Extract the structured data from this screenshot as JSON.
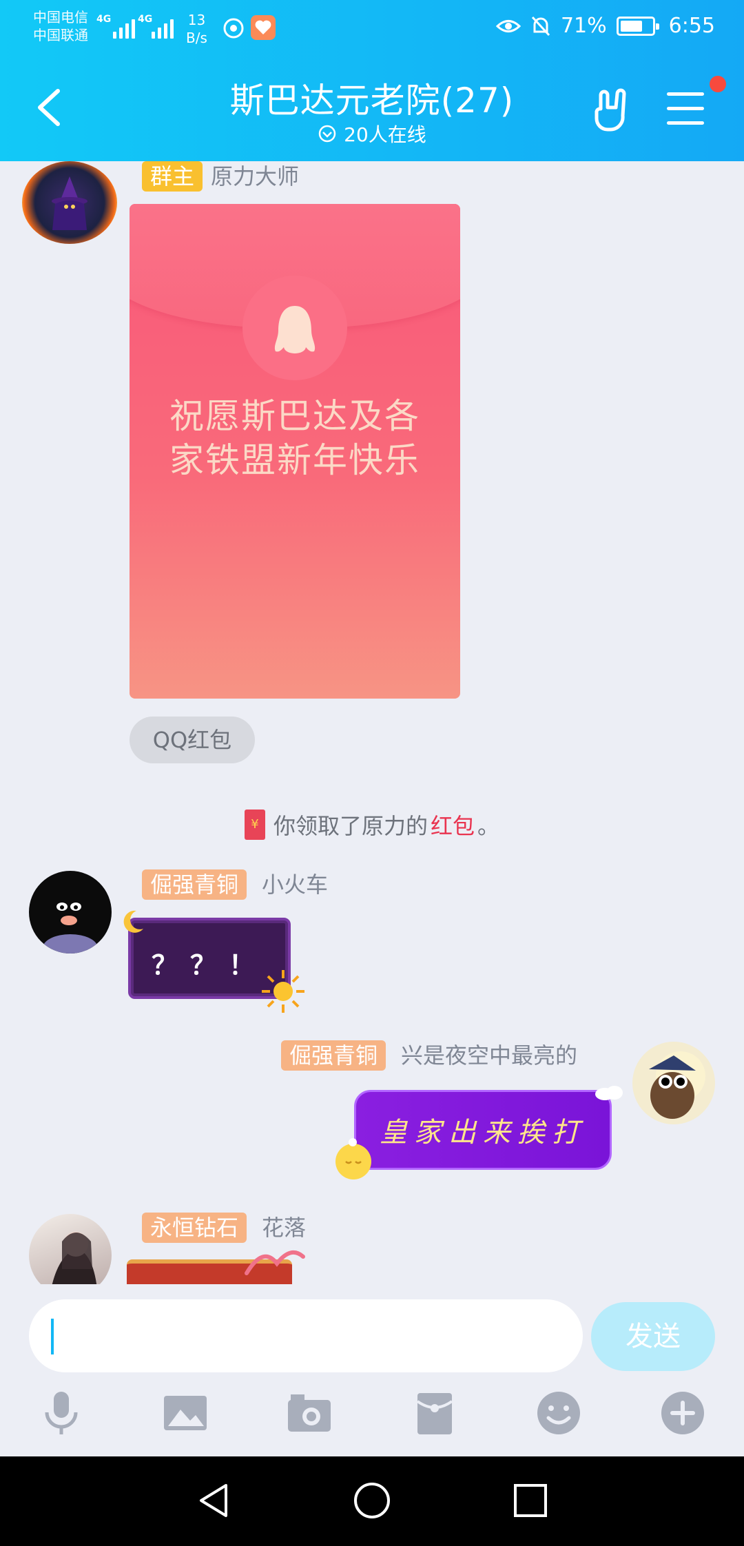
{
  "status_bar": {
    "carrier1": "中国电信",
    "carrier2": "中国联通",
    "net1": "4G",
    "net2": "4G",
    "speed_value": "13",
    "speed_unit": "B/s",
    "battery": "71%",
    "time": "6:55"
  },
  "header": {
    "title": "斯巴达元老院(27)",
    "online": "20人在线"
  },
  "messages": [
    {
      "badge": "群主",
      "nick": "原力大师",
      "redpacket_text": "祝愿斯巴达及各家铁盟新年快乐",
      "packet_type": "QQ红包"
    },
    {
      "badge": "倔强青铜",
      "nick": "小火车",
      "text": "？？！"
    },
    {
      "badge": "倔强青铜",
      "nick": "兴是夜空中最亮的",
      "text": "皇家出来挨打"
    },
    {
      "badge": "永恒钻石",
      "nick": "花落"
    }
  ],
  "system_message": {
    "prefix": "你领取了原力的",
    "highlight": "红包",
    "suffix": "。",
    "icon_char": "¥"
  },
  "input": {
    "send_label": "发送"
  },
  "colors": {
    "header": "#13b6f6",
    "gold_badge": "#f9c02f",
    "bronze_badge": "#f7b384",
    "highlight": "#e9334f"
  },
  "icons": [
    "back-icon",
    "online-check-icon",
    "hand-gesture-icon",
    "menu-icon",
    "mic-icon",
    "image-icon",
    "camera-icon",
    "red-packet-icon",
    "emoji-icon",
    "plus-icon",
    "nav-back-icon",
    "nav-home-icon",
    "nav-recents-icon"
  ]
}
